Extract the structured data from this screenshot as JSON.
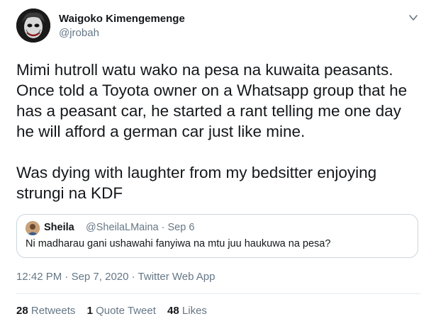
{
  "author": {
    "name": "Waigoko Kimengemenge",
    "handle": "@jrobah"
  },
  "tweet": {
    "text": "Mimi hutroll watu wako na pesa na kuwaita peasants.\nOnce told a Toyota owner on a Whatsapp group that he\nhas a peasant car, he started a rant telling me one day\nhe will afford a german car just like mine.\n\nWas dying with laughter from my bedsitter enjoying\nstrungi na KDF"
  },
  "quoted": {
    "name": "Sheila",
    "handle": "@SheilaLMaina",
    "date": "Sep 6",
    "separator": "·",
    "text": "Ni madharau gani ushawahi fanyiwa na mtu juu haukuwa na pesa?"
  },
  "meta": {
    "time": "12:42 PM",
    "date": "Sep 7, 2020",
    "source": "Twitter Web App",
    "separator": "·"
  },
  "stats": {
    "retweets_count": "28",
    "retweets_label": "Retweets",
    "quotes_count": "1",
    "quotes_label": "Quote Tweet",
    "likes_count": "48",
    "likes_label": "Likes"
  },
  "icons": {
    "caret": "chevron-down-icon"
  },
  "colors": {
    "secondary_text": "#657786",
    "border": "#ccd6dd"
  }
}
